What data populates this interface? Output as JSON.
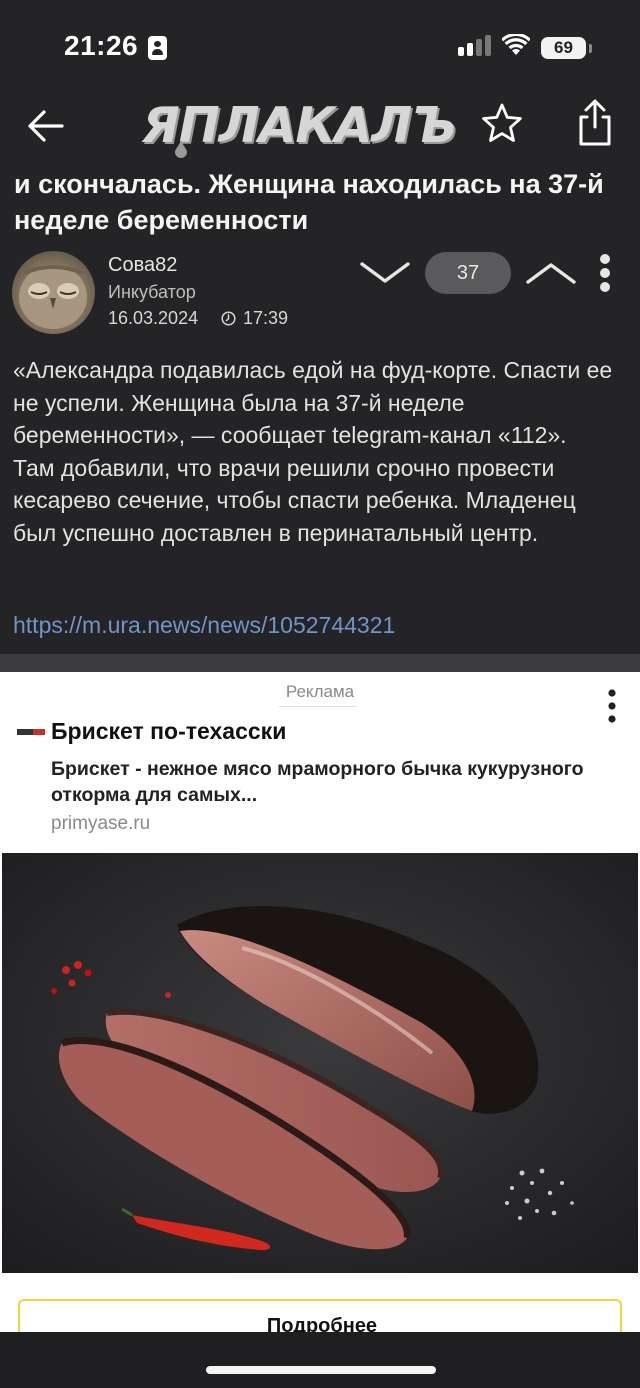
{
  "status_bar": {
    "time": "21:26",
    "battery": "69"
  },
  "header": {
    "logo_text": "ЯПЛАКАЛЪ"
  },
  "post": {
    "title": "и скончалась. Женщина находилась на 37-й неделе беременности",
    "author": {
      "name": "Сова82",
      "rank": "Инкубатор",
      "date": "16.03.2024",
      "time": "17:39"
    },
    "score": "37",
    "body": "«Александра подавилась едой на фуд-корте. Спасти ее не успели. Женщина была на 37-й неделе беременности», — сообщает telegram-канал «112». Там добавили, что врачи решили срочно провести кесарево сечение, чтобы спасти ребенка. Младенец был успешно доставлен в перинатальный центр.",
    "link": "https://m.ura.news/news/1052744321"
  },
  "ad": {
    "label": "Реклама",
    "title": "Брискет по-техасски",
    "description": "Брискет - нежное мясо мраморного бычка кукурузного откорма для самых...",
    "domain": "primyase.ru",
    "button_label": "Подробнее",
    "slides_total": 2,
    "slide_active": 1
  },
  "colors": {
    "background": "#242426",
    "link": "#6f95c9",
    "cta_border": "#f0d43a",
    "score_pill": "#5a5a5c"
  }
}
